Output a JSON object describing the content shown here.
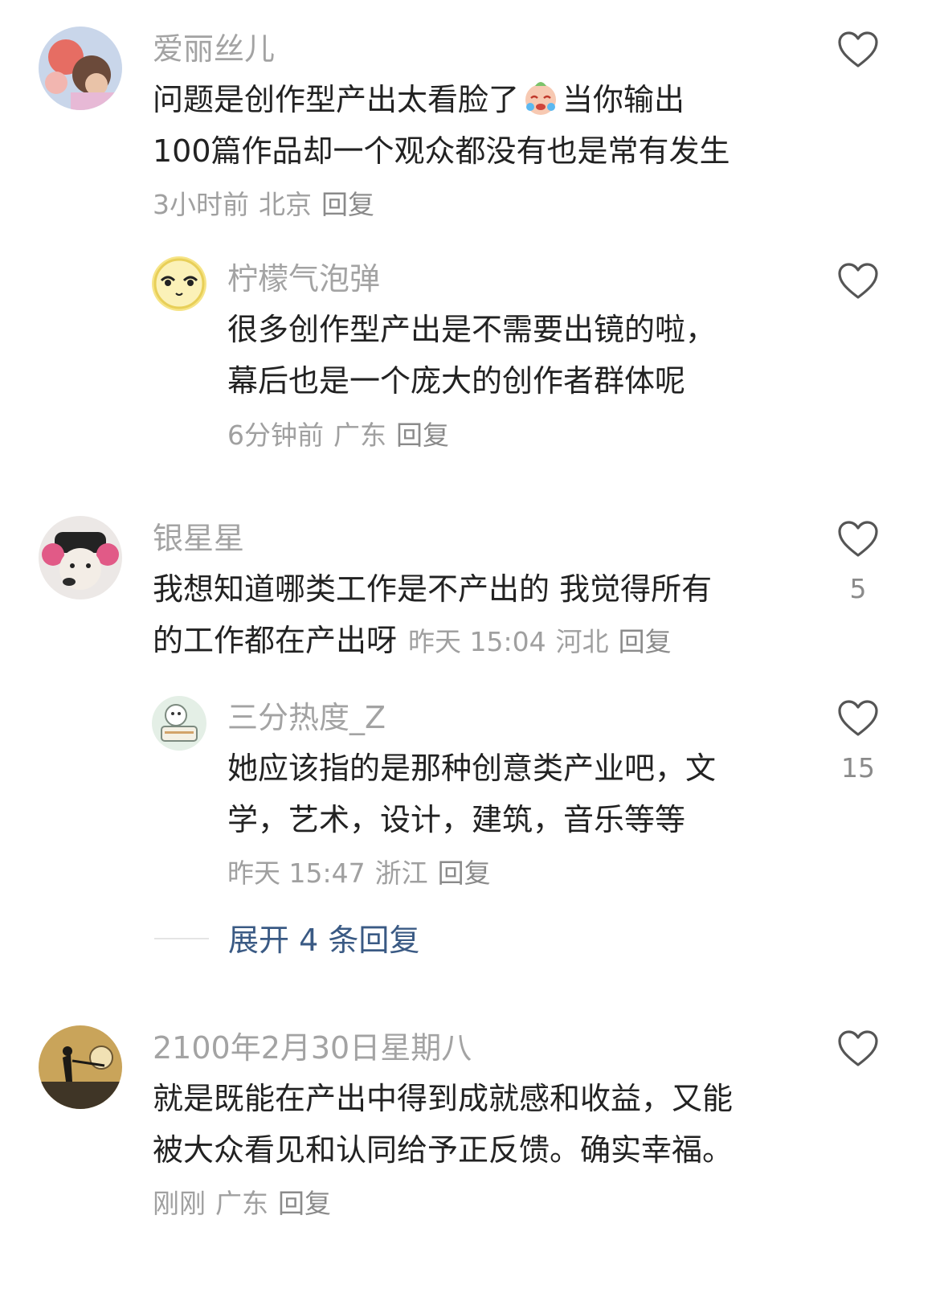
{
  "comments": [
    {
      "author": "爱丽丝儿",
      "text_line1_before_emoji": "问题是创作型产出太看脸了",
      "emoji": "crying-face-emoji",
      "text_line1_after_emoji": "当你输出",
      "text_line2": "100篇作品却一个观众都没有也是常有发生",
      "time": "3小时前",
      "location": "北京",
      "reply_label": "回复",
      "likes": ""
    },
    {
      "author": "柠檬气泡弹",
      "text_line1": "很多创作型产出是不需要出镜的啦，",
      "text_line2": "幕后也是一个庞大的创作者群体呢",
      "time": "6分钟前",
      "location": "广东",
      "reply_label": "回复",
      "likes": ""
    },
    {
      "author": "银星星",
      "text_line1": "我想知道哪类工作是不产出的 我觉得所有",
      "text_line2": "的工作都在产出呀",
      "time": "昨天 15:04",
      "location": "河北",
      "reply_label": "回复",
      "likes": "5"
    },
    {
      "author": "三分热度_Z",
      "text_line1": "她应该指的是那种创意类产业吧，文",
      "text_line2": "学，艺术，设计，建筑，音乐等等",
      "time": "昨天 15:47",
      "location": "浙江",
      "reply_label": "回复",
      "likes": "15"
    },
    {
      "author": "2100年2月30日星期八",
      "text_line1": "就是既能在产出中得到成就感和收益，又能",
      "text_line2": "被大众看见和认同给予正反馈。确实幸福。",
      "time": "刚刚",
      "location": "广东",
      "reply_label": "回复",
      "likes": ""
    }
  ],
  "expand_replies": "展开 4 条回复",
  "colors": {
    "author": "#a3a3a3",
    "text": "#222222",
    "meta": "#a0a0a0",
    "link": "#3a5a84",
    "icon": "#555555"
  },
  "icons": {
    "like": "heart-outline-icon"
  }
}
